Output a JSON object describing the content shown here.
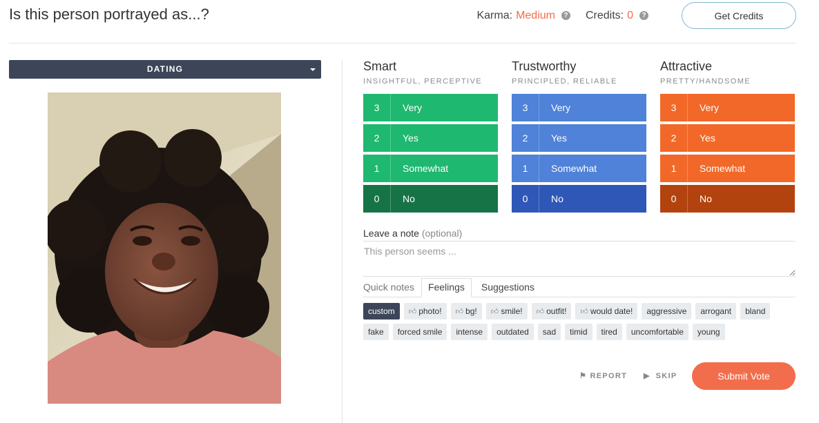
{
  "header": {
    "title": "Is this person portrayed as...?",
    "karma_label": "Karma:",
    "karma_value": "Medium",
    "credits_label": "Credits:",
    "credits_value": "0",
    "get_credits_label": "Get Credits",
    "help_icon": "question-circle-icon"
  },
  "category": {
    "selected": "DATING"
  },
  "traits": [
    {
      "name": "Smart",
      "subtitle": "INSIGHTFUL, PERCEPTIVE",
      "color": "#1fb870",
      "color_dark": "#167346",
      "options": [
        {
          "num": "3",
          "label": "Very"
        },
        {
          "num": "2",
          "label": "Yes"
        },
        {
          "num": "1",
          "label": "Somewhat"
        },
        {
          "num": "0",
          "label": "No"
        }
      ]
    },
    {
      "name": "Trustworthy",
      "subtitle": "PRINCIPLED, RELIABLE",
      "color": "#4f82d8",
      "color_dark": "#2e57b7",
      "options": [
        {
          "num": "3",
          "label": "Very"
        },
        {
          "num": "2",
          "label": "Yes"
        },
        {
          "num": "1",
          "label": "Somewhat"
        },
        {
          "num": "0",
          "label": "No"
        }
      ]
    },
    {
      "name": "Attractive",
      "subtitle": "PRETTY/HANDSOME",
      "color": "#f26828",
      "color_dark": "#b3430e",
      "options": [
        {
          "num": "3",
          "label": "Very"
        },
        {
          "num": "2",
          "label": "Yes"
        },
        {
          "num": "1",
          "label": "Somewhat"
        },
        {
          "num": "0",
          "label": "No"
        }
      ]
    }
  ],
  "note": {
    "label": "Leave a note",
    "optional": "(optional)",
    "placeholder": "This person seems ..."
  },
  "tabs": [
    {
      "label": "Quick notes"
    },
    {
      "label": "Feelings"
    },
    {
      "label": "Suggestions"
    }
  ],
  "chips": [
    {
      "label": "custom",
      "selected": true,
      "thumb": false
    },
    {
      "label": "photo!",
      "thumb": true
    },
    {
      "label": "bg!",
      "thumb": true
    },
    {
      "label": "smile!",
      "thumb": true
    },
    {
      "label": "outfit!",
      "thumb": true
    },
    {
      "label": "would date!",
      "thumb": true
    },
    {
      "label": "aggressive"
    },
    {
      "label": "arrogant"
    },
    {
      "label": "bland"
    },
    {
      "label": "fake"
    },
    {
      "label": "forced smile"
    },
    {
      "label": "intense"
    },
    {
      "label": "outdated"
    },
    {
      "label": "sad"
    },
    {
      "label": "timid"
    },
    {
      "label": "tired"
    },
    {
      "label": "uncomfortable"
    },
    {
      "label": "young"
    }
  ],
  "actions": {
    "report": "REPORT",
    "skip": "SKIP",
    "submit": "Submit Vote"
  },
  "colors": {
    "accent": "#f26d4b",
    "navy": "#3d4559"
  }
}
